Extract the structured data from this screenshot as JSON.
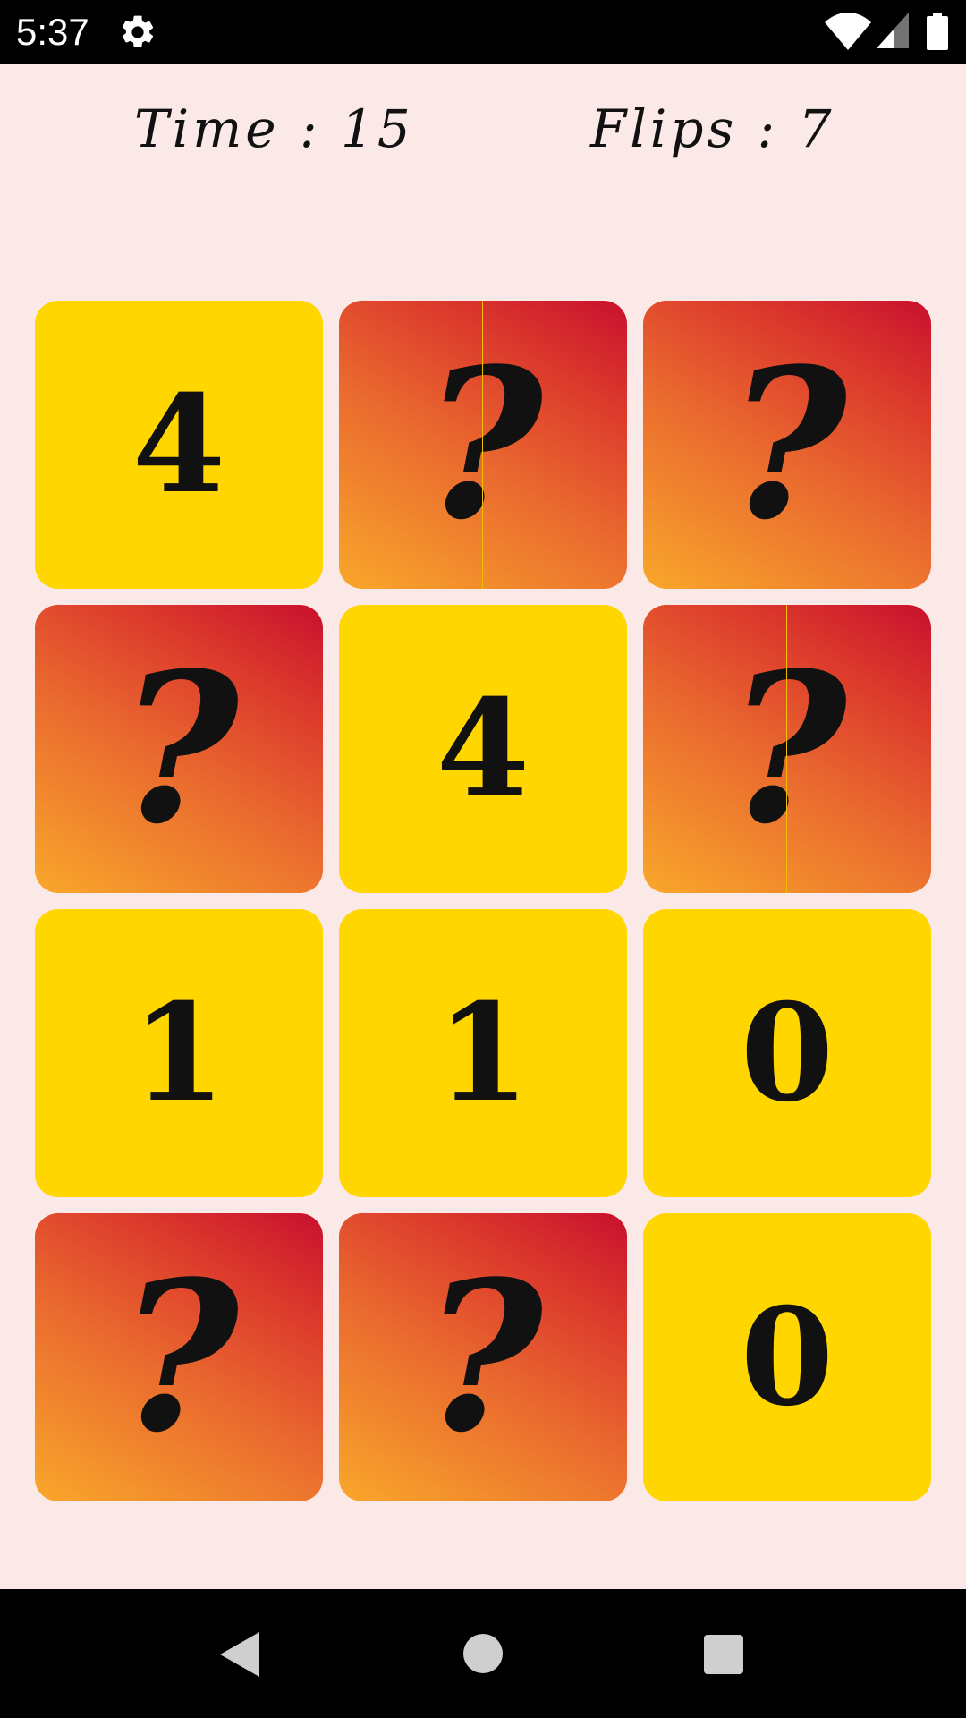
{
  "status_bar": {
    "time": "5:37",
    "icons": [
      "settings-gear-icon",
      "wifi-icon",
      "cell-signal-icon",
      "battery-icon"
    ]
  },
  "hud": {
    "time_label": "Time : 15",
    "flips_label": "Flips : 7"
  },
  "board": {
    "cards": [
      {
        "state": "face-up",
        "symbol": "4"
      },
      {
        "state": "face-down",
        "symbol": "?"
      },
      {
        "state": "face-down",
        "symbol": "?"
      },
      {
        "state": "face-down",
        "symbol": "?"
      },
      {
        "state": "face-up",
        "symbol": "4"
      },
      {
        "state": "face-down",
        "symbol": "?"
      },
      {
        "state": "face-up",
        "symbol": "1"
      },
      {
        "state": "face-up",
        "symbol": "1"
      },
      {
        "state": "face-up",
        "symbol": "0"
      },
      {
        "state": "face-down",
        "symbol": "?"
      },
      {
        "state": "face-down",
        "symbol": "?"
      },
      {
        "state": "face-up",
        "symbol": "0"
      }
    ]
  },
  "colors": {
    "background": "#fbe9e7",
    "card_face_up": "#ffd600",
    "card_back_gradient_start": "#f9a72b",
    "card_back_gradient_end": "#c8102e"
  },
  "nav_bar": {
    "icons": [
      "back-icon",
      "home-icon",
      "recents-icon"
    ]
  }
}
